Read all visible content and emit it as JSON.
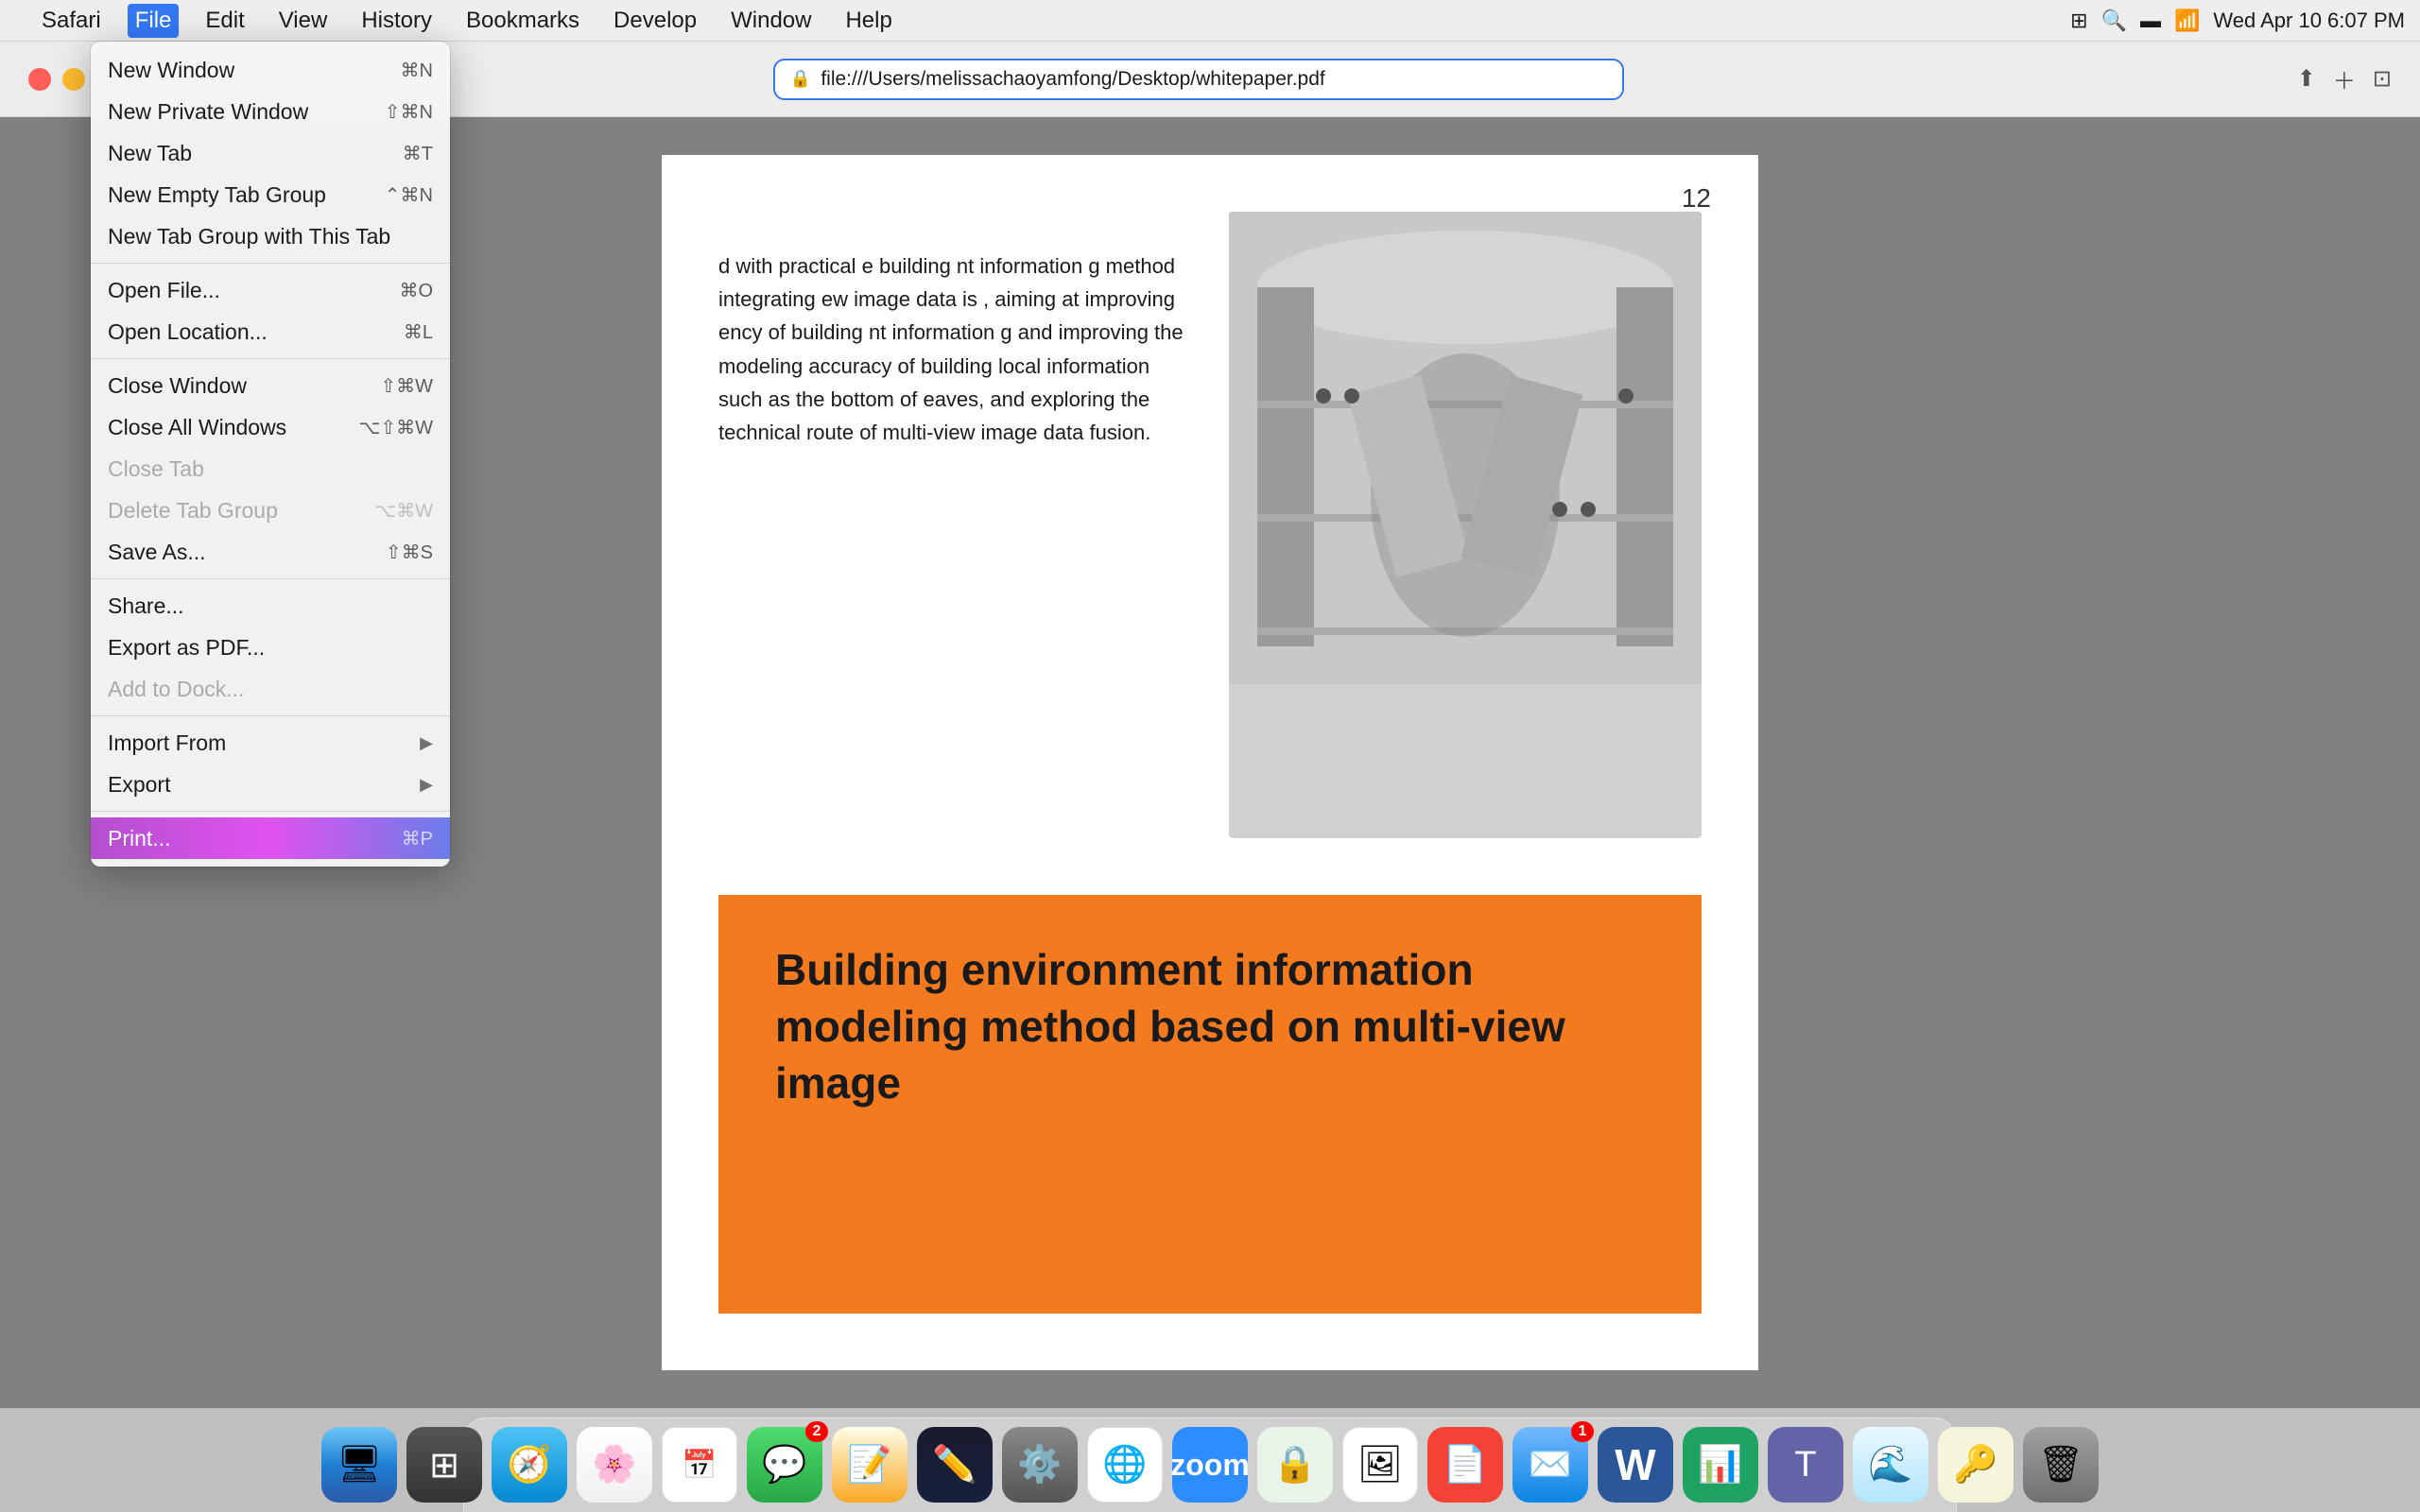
{
  "menubar": {
    "apple_logo": "",
    "app_name": "Safari",
    "menus": [
      "File",
      "Edit",
      "View",
      "History",
      "Bookmarks",
      "Develop",
      "Window",
      "Help"
    ],
    "active_menu": "File",
    "right_items": [
      "control_center",
      "search",
      "battery",
      "wifi",
      "time"
    ],
    "time": "Wed Apr 10  6:07 PM"
  },
  "toolbar": {
    "url": "file:///Users/melissachaoyamfong/Desktop/whitepaper.pdf",
    "url_icon": "🔒"
  },
  "pdf": {
    "page_number": "12",
    "text_content": "d with practical e building nt information g method integrating ew image data is , aiming at improving ency of building nt information g and improving the modeling accuracy of building local information such as the bottom of eaves, and exploring the technical route of multi-view image data fusion.",
    "orange_heading": "Building environment information modeling method based on multi-view image"
  },
  "file_menu": {
    "items": [
      {
        "id": "new-window",
        "label": "New Window",
        "shortcut": "⌘N",
        "disabled": false,
        "has_arrow": false
      },
      {
        "id": "new-private-window",
        "label": "New Private Window",
        "shortcut": "⇧⌘N",
        "disabled": false,
        "has_arrow": false
      },
      {
        "id": "new-tab",
        "label": "New Tab",
        "shortcut": "⌘T",
        "disabled": false,
        "has_arrow": false
      },
      {
        "id": "new-empty-tab-group",
        "label": "New Empty Tab Group",
        "shortcut": "⌘N",
        "modifier": "ctrl",
        "disabled": false,
        "has_arrow": false
      },
      {
        "id": "new-tab-group-with-tab",
        "label": "New Tab Group with This Tab",
        "shortcut": "",
        "disabled": false,
        "has_arrow": false
      },
      {
        "divider": true
      },
      {
        "id": "open-file",
        "label": "Open File...",
        "shortcut": "⌘O",
        "disabled": false,
        "has_arrow": false
      },
      {
        "id": "open-location",
        "label": "Open Location...",
        "shortcut": "⌘L",
        "disabled": false,
        "has_arrow": false
      },
      {
        "divider": true
      },
      {
        "id": "close-window",
        "label": "Close Window",
        "shortcut": "⇧⌘W",
        "disabled": false,
        "has_arrow": false
      },
      {
        "id": "close-all-windows",
        "label": "Close All Windows",
        "shortcut": "⌥⇧⌘W",
        "disabled": false,
        "has_arrow": false
      },
      {
        "id": "close-tab",
        "label": "Close Tab",
        "shortcut": "",
        "disabled": true,
        "has_arrow": false
      },
      {
        "id": "delete-tab-group",
        "label": "Delete Tab Group",
        "shortcut": "⌥⌘W",
        "disabled": true,
        "has_arrow": false
      },
      {
        "id": "save-as",
        "label": "Save As...",
        "shortcut": "⇧⌘S",
        "disabled": false,
        "has_arrow": false
      },
      {
        "divider": true
      },
      {
        "id": "share",
        "label": "Share...",
        "shortcut": "",
        "disabled": false,
        "has_arrow": false
      },
      {
        "id": "export-pdf",
        "label": "Export as PDF...",
        "shortcut": "",
        "disabled": false,
        "has_arrow": false
      },
      {
        "id": "add-to-dock",
        "label": "Add to Dock...",
        "shortcut": "",
        "disabled": true,
        "has_arrow": false
      },
      {
        "divider": true
      },
      {
        "id": "import-from",
        "label": "Import From",
        "shortcut": "",
        "disabled": false,
        "has_arrow": true
      },
      {
        "id": "export",
        "label": "Export",
        "shortcut": "",
        "disabled": false,
        "has_arrow": true
      },
      {
        "divider": true
      },
      {
        "id": "print",
        "label": "Print...",
        "shortcut": "⌘P",
        "disabled": false,
        "has_arrow": false,
        "highlighted": true
      }
    ]
  },
  "dock": {
    "items": [
      {
        "id": "finder",
        "label": "Finder",
        "icon_class": "finder-icon",
        "icon_char": "🖥",
        "badge": null
      },
      {
        "id": "launchpad",
        "label": "Launchpad",
        "icon_class": "launchpad-icon",
        "icon_char": "⊞",
        "badge": null
      },
      {
        "id": "safari",
        "label": "Safari",
        "icon_class": "safari-icon",
        "icon_char": "🧭",
        "badge": null
      },
      {
        "id": "photos",
        "label": "Photos",
        "icon_class": "photos-icon",
        "icon_char": "🌸",
        "badge": null
      },
      {
        "id": "calendar",
        "label": "Calendar",
        "icon_class": "calendar-icon",
        "icon_char": "📅",
        "badge": null
      },
      {
        "id": "messages",
        "label": "Messages",
        "icon_class": "messages-icon",
        "icon_char": "💬",
        "badge": "2"
      },
      {
        "id": "notes",
        "label": "Notes",
        "icon_class": "notes-icon",
        "icon_char": "📝",
        "badge": null
      },
      {
        "id": "freeform",
        "label": "Freeform",
        "icon_class": "freeform-icon",
        "icon_char": "✏️",
        "badge": null
      },
      {
        "id": "system-prefs",
        "label": "System Preferences",
        "icon_class": "syspref-icon",
        "icon_char": "⚙️",
        "badge": null
      },
      {
        "id": "chrome",
        "label": "Chrome",
        "icon_class": "chrome-icon",
        "icon_char": "🌐",
        "badge": null
      },
      {
        "id": "zoom",
        "label": "Zoom",
        "icon_class": "zoom-icon",
        "icon_char": "📹",
        "badge": null
      },
      {
        "id": "mullvad",
        "label": "Mullvad",
        "icon_class": "mullvad-icon",
        "icon_char": "🔒",
        "badge": null
      },
      {
        "id": "preview",
        "label": "Preview",
        "icon_class": "preview-icon",
        "icon_char": "👁",
        "badge": null
      },
      {
        "id": "acrobat",
        "label": "Acrobat",
        "icon_class": "acrobat-icon",
        "icon_char": "📄",
        "badge": null
      },
      {
        "id": "mail",
        "label": "Mail",
        "icon_class": "mail-icon",
        "icon_char": "✉️",
        "badge": "1"
      },
      {
        "id": "word",
        "label": "Word",
        "icon_class": "word-icon",
        "icon_char": "W",
        "badge": null
      },
      {
        "id": "numbers",
        "label": "Numbers",
        "icon_class": "numbers-icon",
        "icon_char": "N",
        "badge": null
      },
      {
        "id": "teams",
        "label": "Teams",
        "icon_class": "teams-icon",
        "icon_char": "T",
        "badge": null
      },
      {
        "id": "wavy",
        "label": "Wavy",
        "icon_class": "wavy-icon",
        "icon_char": "~",
        "badge": null
      },
      {
        "id": "keychain",
        "label": "Keychain",
        "icon_char": "🔑",
        "icon_class": "keychain-icon",
        "badge": null
      },
      {
        "id": "trash",
        "label": "Trash",
        "icon_class": "trash-icon",
        "icon_char": "🗑",
        "badge": null
      }
    ]
  }
}
